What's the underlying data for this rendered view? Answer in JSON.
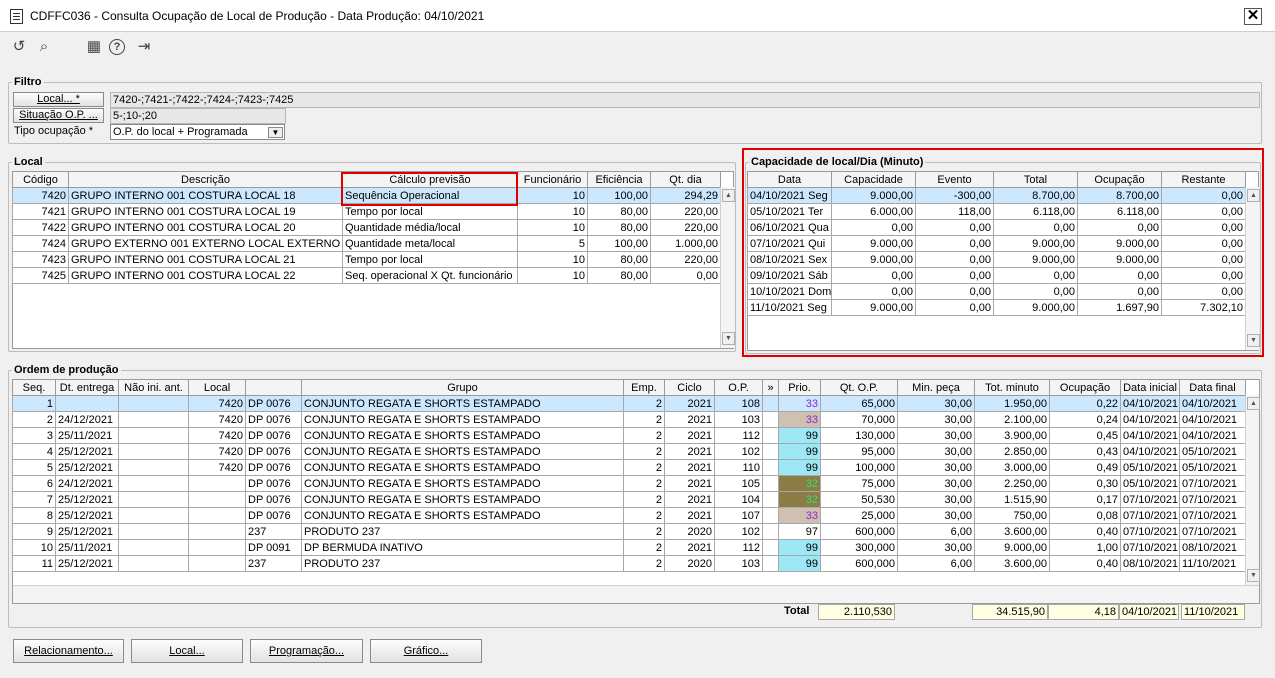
{
  "window": {
    "title": "CDFFC036 - Consulta Ocupação de Local de Produção - Data Produção: 04/10/2021",
    "close": "✕"
  },
  "toolbar": {
    "refresh": "↺",
    "search": "⌕",
    "calendar": "▦",
    "help": "?",
    "exit": "⇥"
  },
  "filtro": {
    "label": "Filtro",
    "local_button": "Local... *",
    "local_value": "7420-;7421-;7422-;7424-;7423-;7425",
    "situacao_button": "Situação O.P. ...",
    "situacao_value": "5-;10-;20",
    "tipo_label": "Tipo ocupação *",
    "tipo_value": "O.P. do local + Programada"
  },
  "local": {
    "label": "Local",
    "columns": [
      "Código",
      "Descrição",
      "Cálculo previsão",
      "Funcionário",
      "Eficiência",
      "Qt. dia"
    ],
    "rows": [
      [
        "7420",
        "GRUPO INTERNO 001 COSTURA LOCAL 18",
        "Sequência Operacional",
        "10",
        "100,00",
        "294,29"
      ],
      [
        "7421",
        "GRUPO INTERNO 001 COSTURA LOCAL 19",
        "Tempo por local",
        "10",
        "80,00",
        "220,00"
      ],
      [
        "7422",
        "GRUPO INTERNO 001 COSTURA LOCAL 20",
        "Quantidade média/local",
        "10",
        "80,00",
        "220,00"
      ],
      [
        "7424",
        "GRUPO EXTERNO 001 EXTERNO LOCAL EXTERNO",
        "Quantidade meta/local",
        "5",
        "100,00",
        "1.000,00"
      ],
      [
        "7423",
        "GRUPO INTERNO 001 COSTURA LOCAL 21",
        "Tempo por local",
        "10",
        "80,00",
        "220,00"
      ],
      [
        "7425",
        "GRUPO INTERNO 001 COSTURA LOCAL 22",
        "Seq. operacional X Qt. funcionário",
        "10",
        "80,00",
        "0,00"
      ]
    ]
  },
  "capacidade": {
    "label": "Capacidade de local/Dia (Minuto)",
    "columns": [
      "Data",
      "Capacidade",
      "Evento",
      "Total",
      "Ocupação",
      "Restante"
    ],
    "rows": [
      [
        "04/10/2021 Seg",
        "9.000,00",
        "-300,00",
        "8.700,00",
        "8.700,00",
        "0,00"
      ],
      [
        "05/10/2021 Ter",
        "6.000,00",
        "118,00",
        "6.118,00",
        "6.118,00",
        "0,00"
      ],
      [
        "06/10/2021 Qua",
        "0,00",
        "0,00",
        "0,00",
        "0,00",
        "0,00"
      ],
      [
        "07/10/2021 Qui",
        "9.000,00",
        "0,00",
        "9.000,00",
        "9.000,00",
        "0,00"
      ],
      [
        "08/10/2021 Sex",
        "9.000,00",
        "0,00",
        "9.000,00",
        "9.000,00",
        "0,00"
      ],
      [
        "09/10/2021 Sáb",
        "0,00",
        "0,00",
        "0,00",
        "0,00",
        "0,00"
      ],
      [
        "10/10/2021 Dom",
        "0,00",
        "0,00",
        "0,00",
        "0,00",
        "0,00"
      ],
      [
        "11/10/2021 Seg",
        "9.000,00",
        "0,00",
        "9.000,00",
        "1.697,90",
        "7.302,10"
      ]
    ]
  },
  "ordem": {
    "label": "Ordem de produção",
    "columns": [
      "Seq.",
      "Dt. entrega",
      "Não ini. ant.",
      "Local",
      "",
      "Grupo",
      "Emp.",
      "Ciclo",
      "O.P.",
      "»",
      "Prio.",
      "Qt. O.P.",
      "Min. peça",
      "Tot. minuto",
      "Ocupação",
      "Data inicial",
      "Data final"
    ],
    "rows": [
      [
        "1",
        "",
        "",
        "7420",
        "DP 0076",
        "CONJUNTO REGATA E SHORTS ESTAMPADO",
        "2",
        "2021",
        "108",
        "",
        "33",
        "65,000",
        "30,00",
        "1.950,00",
        "0,22",
        "04/10/2021",
        "04/10/2021"
      ],
      [
        "2",
        "24/12/2021",
        "",
        "7420",
        "DP 0076",
        "CONJUNTO REGATA E SHORTS ESTAMPADO",
        "2",
        "2021",
        "103",
        "",
        "33",
        "70,000",
        "30,00",
        "2.100,00",
        "0,24",
        "04/10/2021",
        "04/10/2021"
      ],
      [
        "3",
        "25/11/2021",
        "",
        "7420",
        "DP 0076",
        "CONJUNTO REGATA E SHORTS ESTAMPADO",
        "2",
        "2021",
        "112",
        "",
        "99",
        "130,000",
        "30,00",
        "3.900,00",
        "0,45",
        "04/10/2021",
        "04/10/2021"
      ],
      [
        "4",
        "25/12/2021",
        "",
        "7420",
        "DP 0076",
        "CONJUNTO REGATA E SHORTS ESTAMPADO",
        "2",
        "2021",
        "102",
        "",
        "99",
        "95,000",
        "30,00",
        "2.850,00",
        "0,43",
        "04/10/2021",
        "05/10/2021"
      ],
      [
        "5",
        "25/12/2021",
        "",
        "7420",
        "DP 0076",
        "CONJUNTO REGATA E SHORTS ESTAMPADO",
        "2",
        "2021",
        "110",
        "",
        "99",
        "100,000",
        "30,00",
        "3.000,00",
        "0,49",
        "05/10/2021",
        "05/10/2021"
      ],
      [
        "6",
        "24/12/2021",
        "",
        "",
        "DP 0076",
        "CONJUNTO REGATA E SHORTS ESTAMPADO",
        "2",
        "2021",
        "105",
        "",
        "32",
        "75,000",
        "30,00",
        "2.250,00",
        "0,30",
        "05/10/2021",
        "07/10/2021"
      ],
      [
        "7",
        "25/12/2021",
        "",
        "",
        "DP 0076",
        "CONJUNTO REGATA E SHORTS ESTAMPADO",
        "2",
        "2021",
        "104",
        "",
        "32",
        "50,530",
        "30,00",
        "1.515,90",
        "0,17",
        "07/10/2021",
        "07/10/2021"
      ],
      [
        "8",
        "25/12/2021",
        "",
        "",
        "DP 0076",
        "CONJUNTO REGATA E SHORTS ESTAMPADO",
        "2",
        "2021",
        "107",
        "",
        "33",
        "25,000",
        "30,00",
        "750,00",
        "0,08",
        "07/10/2021",
        "07/10/2021"
      ],
      [
        "9",
        "25/12/2021",
        "",
        "",
        "237",
        "PRODUTO 237",
        "2",
        "2020",
        "102",
        "",
        "97",
        "600,000",
        "6,00",
        "3.600,00",
        "0,40",
        "07/10/2021",
        "07/10/2021"
      ],
      [
        "10",
        "25/11/2021",
        "",
        "",
        "DP 0091",
        "DP BERMUDA INATIVO",
        "2",
        "2021",
        "112",
        "",
        "99",
        "300,000",
        "30,00",
        "9.000,00",
        "1,00",
        "07/10/2021",
        "08/10/2021"
      ],
      [
        "11",
        "25/12/2021",
        "",
        "",
        "237",
        "PRODUTO 237",
        "2",
        "2020",
        "103",
        "",
        "99",
        "600,000",
        "6,00",
        "3.600,00",
        "0,40",
        "08/10/2021",
        "11/10/2021"
      ]
    ],
    "prio_colors": [
      "a",
      "a",
      "b",
      "b",
      "b",
      "c",
      "c",
      "a",
      "d",
      "b",
      "b"
    ],
    "total_label": "Total",
    "total_qt": "2.110,530",
    "total_minuto": "34.515,90",
    "total_ocupacao": "4,18",
    "total_data_inicial": "04/10/2021",
    "total_data_final": "11/10/2021"
  },
  "buttons": {
    "relacionamento": "Relacionamento...",
    "local": "Local...",
    "programacao": "Programação...",
    "grafico": "Gráfico..."
  }
}
